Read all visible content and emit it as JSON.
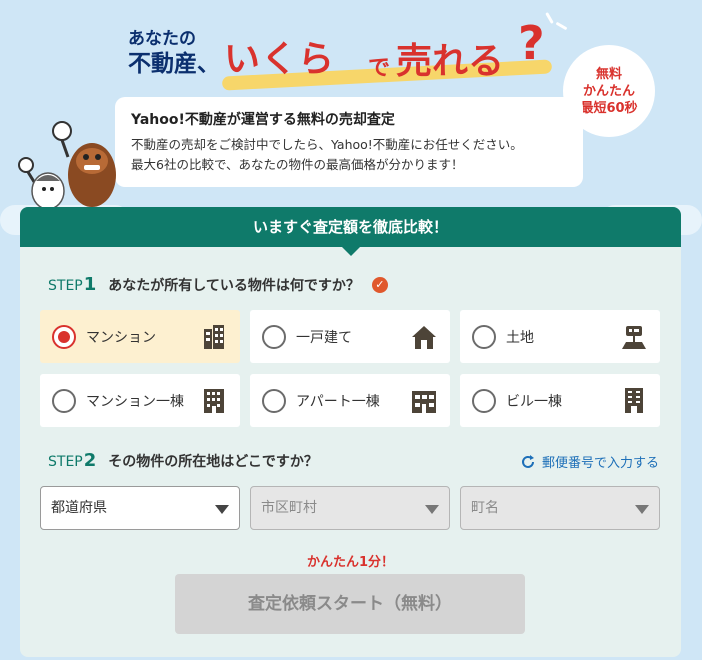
{
  "headline": {
    "line1": "あなたの",
    "line2": "不動産、",
    "big": "いくら",
    "de": "で",
    "ureru": "売れる",
    "q": "?"
  },
  "badge": {
    "line1": "無料",
    "line2": "かんたん",
    "line3": "最短60秒"
  },
  "intro": {
    "title": "Yahoo!不動産が運営する無料の売却査定",
    "line1": "不動産の売却をご検討中でしたら、Yahoo!不動産にお任せください。",
    "line2": "最大6社の比較で、あなたの物件の最高価格が分かります！"
  },
  "card": {
    "header": "いますぐ査定額を徹底比較！"
  },
  "step1": {
    "tag": "STEP",
    "num": "1",
    "question": "あなたが所有している物件は何ですか？",
    "options": [
      {
        "label": "マンション",
        "selected": true,
        "icon": "building-icon"
      },
      {
        "label": "一戸建て",
        "selected": false,
        "icon": "house-icon"
      },
      {
        "label": "土地",
        "selected": false,
        "icon": "land-icon"
      },
      {
        "label": "マンション一棟",
        "selected": false,
        "icon": "building-icon"
      },
      {
        "label": "アパート一棟",
        "selected": false,
        "icon": "apartment-icon"
      },
      {
        "label": "ビル一棟",
        "selected": false,
        "icon": "office-building-icon"
      }
    ]
  },
  "step2": {
    "tag": "STEP",
    "num": "2",
    "question": "その物件の所在地はどこですか？",
    "zip_link": "郵便番号で入力する",
    "prefecture": "都道府県",
    "city": "市区町村",
    "town": "町名"
  },
  "cta": {
    "note": "かんたん1分！",
    "label": "査定依頼スタート（無料）"
  },
  "colors": {
    "accent": "#0f7a6a",
    "brand_red": "#d9322d",
    "link": "#1d6fb8"
  }
}
